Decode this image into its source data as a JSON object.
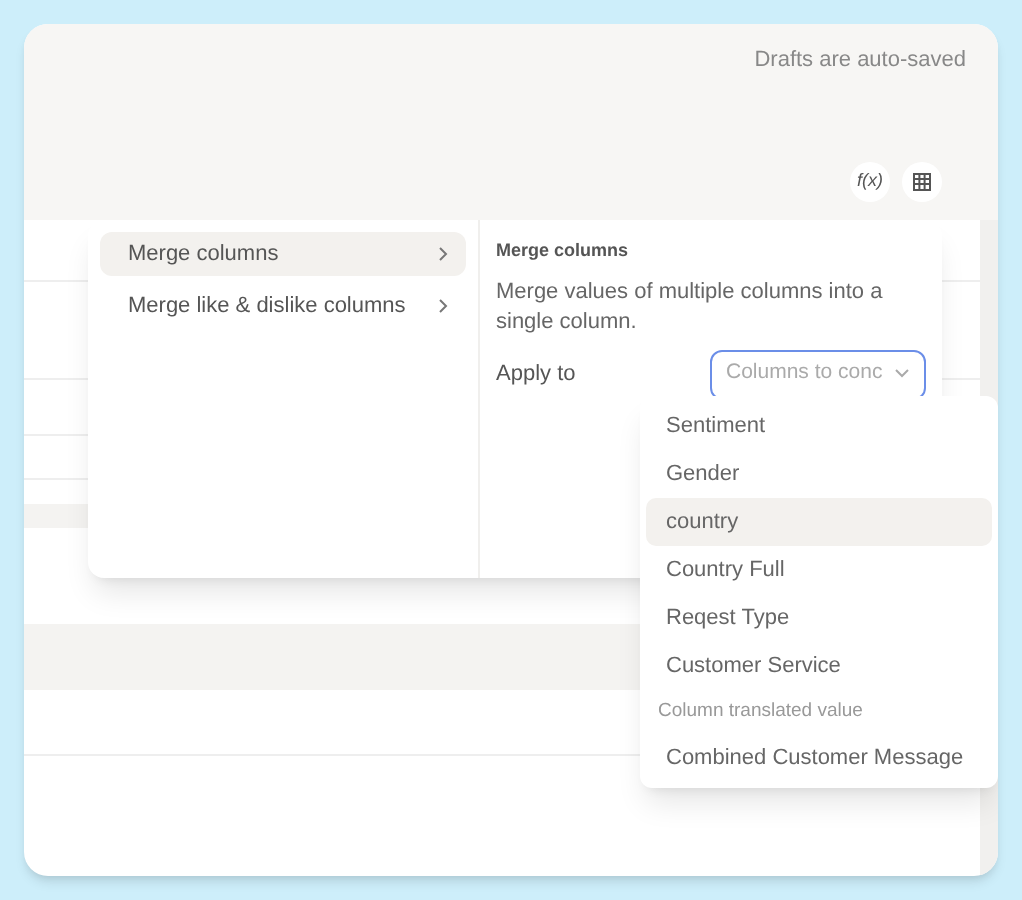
{
  "header": {
    "status": "Drafts are auto-saved"
  },
  "toolbar": [
    {
      "kind": "formula",
      "text": "f(x)"
    },
    {
      "kind": "table"
    }
  ],
  "menu": {
    "items": [
      {
        "label": "Merge columns",
        "selected": true
      },
      {
        "label": "Merge like & dislike columns",
        "selected": false
      }
    ]
  },
  "detail": {
    "title": "Merge columns",
    "description": "Merge values of multiple columns into a single column.",
    "apply_label": "Apply to",
    "select": {
      "placeholder": "Columns to conc",
      "focused": true
    }
  },
  "dropdown": {
    "items": [
      {
        "kind": "option",
        "label": "Sentiment",
        "selected": false
      },
      {
        "kind": "option",
        "label": "Gender",
        "selected": false
      },
      {
        "kind": "option",
        "label": "country",
        "selected": true
      },
      {
        "kind": "option",
        "label": "Country Full",
        "selected": false
      },
      {
        "kind": "option",
        "label": "Reqest Type",
        "selected": false
      },
      {
        "kind": "option",
        "label": "Customer Service",
        "selected": false
      },
      {
        "kind": "group",
        "label": "Column translated value"
      },
      {
        "kind": "option",
        "label": "Combined Customer Message",
        "selected": false
      }
    ]
  }
}
